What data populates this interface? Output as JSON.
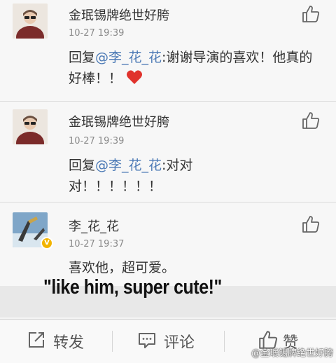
{
  "comments": [
    {
      "name": "金珉锡牌绝世好胯",
      "time": "10-27 19:39",
      "prefix": "回复",
      "mention": "@李_花_花",
      "text": ":谢谢导演的喜欢！他真的好棒！！",
      "emoji": "heart-icon"
    },
    {
      "name": "金珉锡牌绝世好胯",
      "time": "10-27 19:39",
      "prefix": "回复",
      "mention": "@李_花_花",
      "text": ":对对对！！！！！！"
    },
    {
      "name": "李_花_花",
      "time": "10-27 19:37",
      "text": "喜欢他，超可爱。",
      "verified": true
    }
  ],
  "caption": "\"like him, super cute!\"",
  "toolbar": {
    "repost_label": "转发",
    "comment_label": "评论",
    "like_label": "赞"
  },
  "watermark": "@金珉锡牌绝世好胯",
  "colors": {
    "mention": "#4b79b5",
    "heart": "#e0322c",
    "badge": "#f2b400"
  }
}
